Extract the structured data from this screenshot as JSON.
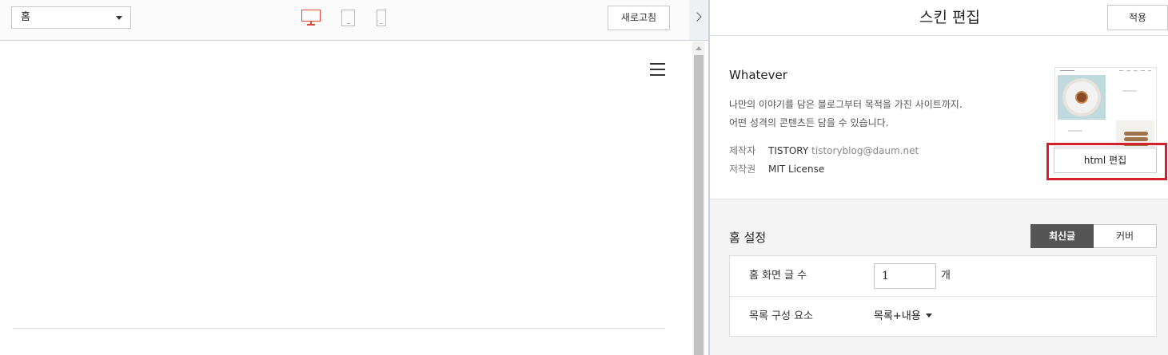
{
  "toolbar": {
    "page_select_value": "홈",
    "refresh_label": "새로고침",
    "active_device": "desktop"
  },
  "panel": {
    "title": "스킨 편집",
    "apply_label": "적용"
  },
  "skin": {
    "name": "Whatever",
    "description_line1": "나만의 이야기를 담은 블로그부터 목적을 가진 사이트까지.",
    "description_line2": "어떤 성격의 콘텐츠든 담을 수 있습니다.",
    "author_key": "제작자",
    "author_name": "TISTORY",
    "author_email": "tistoryblog@daum.net",
    "license_key": "저작권",
    "license_value": "MIT License",
    "html_edit_label": "html 편집"
  },
  "home_settings": {
    "title": "홈 설정",
    "tab_latest": "최신글",
    "tab_cover": "커버",
    "active_tab": "latest",
    "post_count_label": "홈 화면 글 수",
    "post_count_value": "1",
    "post_count_unit": "개",
    "list_component_label": "목록 구성 요소",
    "list_component_value": "목록+내용"
  },
  "colors": {
    "accent_red": "#e0463a",
    "highlight_red": "#d4202a",
    "active_tab_bg": "#555555"
  }
}
